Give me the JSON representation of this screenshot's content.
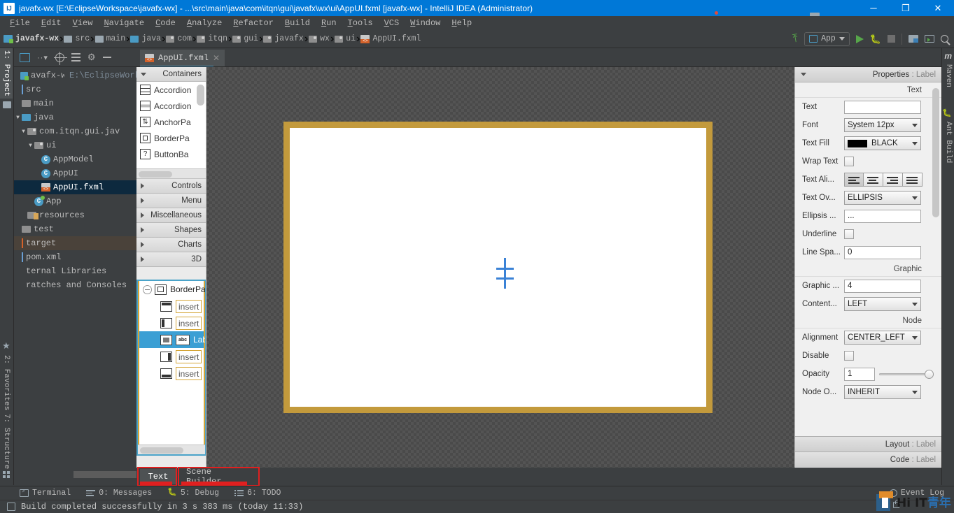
{
  "window": {
    "title": "javafx-wx [E:\\EclipseWorkspace\\javafx-wx] - ...\\src\\main\\java\\com\\itqn\\gui\\javafx\\wx\\ui\\AppUI.fxml [javafx-wx] - IntelliJ IDEA (Administrator)",
    "logo": "IJ",
    "minimize": "─",
    "maximize": "❐",
    "close": "✕"
  },
  "menubar": {
    "items": [
      "File",
      "Edit",
      "View",
      "Navigate",
      "Code",
      "Analyze",
      "Refactor",
      "Build",
      "Run",
      "Tools",
      "VCS",
      "Window",
      "Help"
    ]
  },
  "breadcrumb": {
    "items": [
      {
        "label": "javafx-wx",
        "icon": "module-icon"
      },
      {
        "label": "src",
        "icon": "folder-icon"
      },
      {
        "label": "main",
        "icon": "folder-icon"
      },
      {
        "label": "java",
        "icon": "source-folder-icon"
      },
      {
        "label": "com",
        "icon": "package-icon"
      },
      {
        "label": "itqn",
        "icon": "package-icon"
      },
      {
        "label": "gui",
        "icon": "package-icon"
      },
      {
        "label": "javafx",
        "icon": "package-icon"
      },
      {
        "label": "wx",
        "icon": "package-icon"
      },
      {
        "label": "ui",
        "icon": "package-icon"
      },
      {
        "label": "AppUI.fxml",
        "icon": "fxml-file-icon"
      }
    ],
    "separator": "›"
  },
  "run_toolbar": {
    "back_arrow_icon": "back-arrow-icon",
    "config_name": "App",
    "run_icon": "run-icon",
    "debug_icon": "debug-icon",
    "stop_icon": "stop-icon",
    "project_structure_icon": "project-structure-icon",
    "terminal_icon": "terminal-icon",
    "search_icon": "search-icon"
  },
  "left_strip": {
    "tabs": [
      {
        "label": "1: Project",
        "selected": true,
        "icon": "project-folder-icon"
      },
      {
        "label": "2: Favorites",
        "selected": false,
        "icon": "star-icon"
      },
      {
        "label": "7: Structure",
        "selected": false,
        "icon": "structure-icon"
      }
    ]
  },
  "right_strip": {
    "tabs": [
      {
        "label": "Maven",
        "icon": "maven-icon"
      },
      {
        "label": "Ant Build",
        "icon": "ant-icon"
      }
    ]
  },
  "project_panel": {
    "toolbar": {
      "view_selector": "view-selector-icon",
      "more_icon": "more-options-icon",
      "locate_icon": "scroll-from-source-icon",
      "collapse_icon": "collapse-all-icon",
      "settings_icon": "gear-icon",
      "hide_icon": "hide-panel-icon"
    },
    "tree": [
      {
        "label": "avafx-wx",
        "sublabel": "E:\\EclipseWorksp",
        "icon": "module-icon",
        "depth": 0,
        "arrow": "",
        "state": "root"
      },
      {
        "label": "src",
        "icon": "folder-icon",
        "depth": 0,
        "arrow": "",
        "state": "normal"
      },
      {
        "label": "main",
        "icon": "folder-icon",
        "depth": 1,
        "arrow": "",
        "state": "normal"
      },
      {
        "label": "java",
        "icon": "source-folder-icon",
        "depth": 1,
        "arrow": "▼",
        "state": "normal"
      },
      {
        "label": "com.itqn.gui.jav",
        "icon": "package-icon",
        "depth": 2,
        "arrow": "▼",
        "state": "normal"
      },
      {
        "label": "ui",
        "icon": "package-icon",
        "depth": 3,
        "arrow": "▼",
        "state": "normal"
      },
      {
        "label": "AppModel",
        "icon": "class-icon",
        "depth": 4,
        "arrow": "",
        "state": "normal",
        "badge": "C"
      },
      {
        "label": "AppUI",
        "icon": "class-icon",
        "depth": 4,
        "arrow": "",
        "state": "normal",
        "badge": "C"
      },
      {
        "label": "AppUI.fxml",
        "icon": "fxml-file-icon",
        "depth": 4,
        "arrow": "",
        "state": "selected"
      },
      {
        "label": "App",
        "icon": "runnable-class-icon",
        "depth": 3,
        "arrow": "",
        "state": "normal",
        "badge": "C"
      },
      {
        "label": "resources",
        "icon": "resources-folder-icon",
        "depth": 2,
        "arrow": "",
        "state": "normal"
      },
      {
        "label": "test",
        "icon": "folder-icon",
        "depth": 1,
        "arrow": "",
        "state": "normal"
      },
      {
        "label": "target",
        "icon": "excluded-folder-icon",
        "depth": 0,
        "arrow": "",
        "state": "highlighted"
      },
      {
        "label": "pom.xml",
        "icon": "xml-file-icon",
        "depth": 0,
        "arrow": "",
        "state": "normal"
      },
      {
        "label": "ternal Libraries",
        "icon": "none",
        "depth": 0,
        "arrow": "",
        "state": "normal"
      },
      {
        "label": "ratches and Consoles",
        "icon": "none",
        "depth": 0,
        "arrow": "",
        "state": "normal"
      }
    ]
  },
  "editor_tab": {
    "name": "AppUI.fxml",
    "close": "✕",
    "icon": "fxml-file-icon"
  },
  "scene_builder": {
    "palette": {
      "section_title": "Containers",
      "items": [
        {
          "label": "Accordion",
          "icon": "accordion-icon"
        },
        {
          "label": "Accordion",
          "icon": "accordion-alt-icon"
        },
        {
          "label": "AnchorPa",
          "icon": "anchorpane-icon"
        },
        {
          "label": "BorderPa",
          "icon": "borderpane-icon"
        },
        {
          "label": "ButtonBa",
          "icon": "buttonbar-icon"
        }
      ],
      "collapsed_sections": [
        "Controls",
        "Menu",
        "Miscellaneous",
        "Shapes",
        "Charts",
        "3D"
      ]
    },
    "hierarchy": [
      {
        "label": "BorderPa",
        "icon": "borderpane-icon",
        "type": "root",
        "selected": false
      },
      {
        "label": "insert",
        "icon": "top-region-icon",
        "type": "placeholder",
        "selected": false
      },
      {
        "label": "insert",
        "icon": "left-region-icon",
        "type": "placeholder",
        "selected": false
      },
      {
        "label": "Lab",
        "icon": "label-icon",
        "type": "node",
        "selected": true
      },
      {
        "label": "insert",
        "icon": "right-region-icon",
        "type": "placeholder",
        "selected": false
      },
      {
        "label": "insert",
        "icon": "bottom-region-icon",
        "type": "placeholder",
        "selected": false
      }
    ],
    "inspector": {
      "header": {
        "prefix": "Properties",
        "separator": " : ",
        "target": "Label"
      },
      "sections": [
        {
          "title": "Text",
          "rows": [
            {
              "label": "Text",
              "type": "field",
              "value": ""
            },
            {
              "label": "Font",
              "type": "combo",
              "value": "System 12px"
            },
            {
              "label": "Text Fill",
              "type": "color-combo",
              "value": "BLACK",
              "color": "#000000"
            },
            {
              "label": "Wrap Text",
              "type": "check",
              "value": false
            },
            {
              "label": "Text Ali...",
              "type": "segmented",
              "options": [
                "align-left-icon",
                "align-center-icon",
                "align-right-icon",
                "align-justify-icon"
              ],
              "selected_index": 0
            },
            {
              "label": "Text Ov...",
              "type": "combo",
              "value": "ELLIPSIS"
            },
            {
              "label": "Ellipsis ...",
              "type": "field",
              "value": "..."
            },
            {
              "label": "Underline",
              "type": "check",
              "value": false
            },
            {
              "label": "Line Spa...",
              "type": "field",
              "value": "0"
            }
          ]
        },
        {
          "title": "Graphic",
          "rows": [
            {
              "label": "Graphic ...",
              "type": "field",
              "value": "4"
            },
            {
              "label": "Content...",
              "type": "combo",
              "value": "LEFT"
            }
          ]
        },
        {
          "title": "Node",
          "rows": [
            {
              "label": "Alignment",
              "type": "combo",
              "value": "CENTER_LEFT"
            },
            {
              "label": "Disable",
              "type": "check",
              "value": false
            },
            {
              "label": "Opacity",
              "type": "field-slider",
              "value": "1"
            },
            {
              "label": "Node O...",
              "type": "combo",
              "value": "INHERIT"
            }
          ]
        }
      ],
      "footers": [
        {
          "prefix": "Layout",
          "separator": " : ",
          "target": "Label"
        },
        {
          "prefix": "Code",
          "separator": " : ",
          "target": "Label"
        }
      ]
    },
    "canvas": {
      "border_color": "#c39a3c",
      "background_color": "#ffffff",
      "selection_color": "#3b82d6"
    }
  },
  "bottom_tabs": [
    {
      "label": "Text",
      "active": true,
      "annotated": true
    },
    {
      "label": "Scene Builder",
      "active": false,
      "annotated": true
    }
  ],
  "tool_window_bar": {
    "buttons": [
      {
        "label": "Terminal",
        "icon": "terminal-icon"
      },
      {
        "label": "0: Messages",
        "icon": "messages-icon"
      },
      {
        "label": "5: Debug",
        "icon": "debug-icon"
      },
      {
        "label": "6: TODO",
        "icon": "todo-icon"
      }
    ],
    "event_log": {
      "label": "Event Log",
      "icon": "event-log-icon"
    }
  },
  "status_bar": {
    "message": "Build completed successfully in 3 s 383 ms (today 11:33)",
    "icon": "build-icon",
    "lock_icon": "lock-icon"
  },
  "watermark": {
    "text_latin": "Hi IT",
    "text_cn": "青年"
  }
}
